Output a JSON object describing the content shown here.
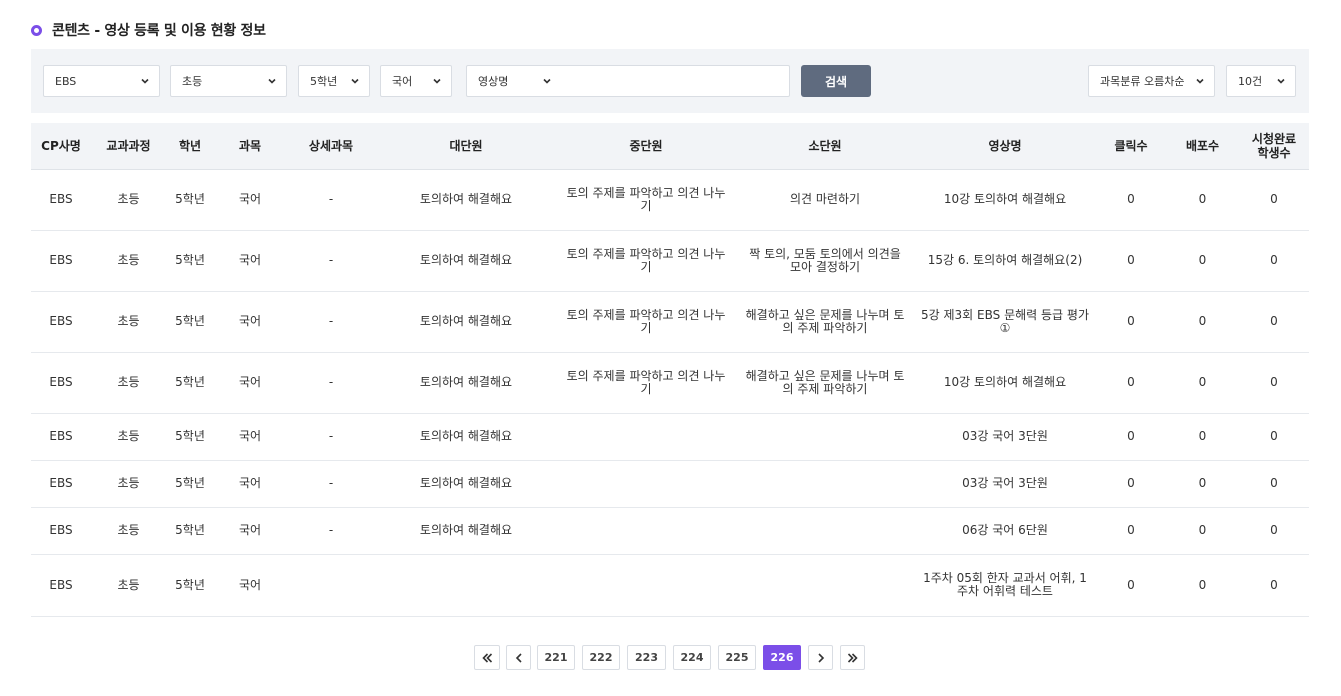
{
  "header": {
    "title": "콘텐츠 - 영상 등록 및 이용 현황 정보"
  },
  "filters": {
    "cp": "EBS",
    "course": "초등",
    "grade": "5학년",
    "subject": "국어",
    "search_type": "영상명",
    "search_value": "",
    "search_button": "검색",
    "sort": "과목분류 오름차순",
    "page_size": "10건"
  },
  "table": {
    "columns": [
      "CP사명",
      "교과과정",
      "학년",
      "과목",
      "상세과목",
      "대단원",
      "중단원",
      "소단원",
      "영상명",
      "클릭수",
      "배포수",
      "시청완료\n학생수"
    ],
    "rows": [
      [
        "EBS",
        "초등",
        "5학년",
        "국어",
        "-",
        "토의하여 해결해요",
        "토의 주제를 파악하고 의견 나누기",
        "의견 마련하기",
        "10강 토의하여 해결해요",
        "0",
        "0",
        "0"
      ],
      [
        "EBS",
        "초등",
        "5학년",
        "국어",
        "-",
        "토의하여 해결해요",
        "토의 주제를 파악하고 의견 나누기",
        "짝 토의, 모둠 토의에서 의견을 모아 결정하기",
        "15강 6. 토의하여 해결해요(2)",
        "0",
        "0",
        "0"
      ],
      [
        "EBS",
        "초등",
        "5학년",
        "국어",
        "-",
        "토의하여 해결해요",
        "토의 주제를 파악하고 의견 나누기",
        "해결하고 싶은 문제를 나누며 토의 주제 파악하기",
        "5강 제3회 EBS 문해력 등급 평가①",
        "0",
        "0",
        "0"
      ],
      [
        "EBS",
        "초등",
        "5학년",
        "국어",
        "-",
        "토의하여 해결해요",
        "토의 주제를 파악하고 의견 나누기",
        "해결하고 싶은 문제를 나누며 토의 주제 파악하기",
        "10강 토의하여 해결해요",
        "0",
        "0",
        "0"
      ],
      [
        "EBS",
        "초등",
        "5학년",
        "국어",
        "-",
        "토의하여 해결해요",
        "",
        "",
        "03강 국어 3단원",
        "0",
        "0",
        "0"
      ],
      [
        "EBS",
        "초등",
        "5학년",
        "국어",
        "-",
        "토의하여 해결해요",
        "",
        "",
        "03강 국어 3단원",
        "0",
        "0",
        "0"
      ],
      [
        "EBS",
        "초등",
        "5학년",
        "국어",
        "-",
        "토의하여 해결해요",
        "",
        "",
        "06강 국어 6단원",
        "0",
        "0",
        "0"
      ],
      [
        "EBS",
        "초등",
        "5학년",
        "국어",
        "",
        "",
        "",
        "",
        "1주차 05회 한자 교과서 어휘, 1주차 어휘력 테스트",
        "0",
        "0",
        "0"
      ]
    ]
  },
  "pagination": {
    "pages": [
      "221",
      "222",
      "223",
      "224",
      "225",
      "226"
    ],
    "current": "226"
  },
  "colors": {
    "accent": "#7b4ee8",
    "search_button": "#5f6b7f",
    "filter_bg": "#f2f4f7"
  },
  "icons": {
    "select": "chevron-down-icon",
    "first": "double-chevron-left-icon",
    "prev": "chevron-left-icon",
    "next": "chevron-right-icon",
    "last": "double-chevron-right-icon"
  }
}
